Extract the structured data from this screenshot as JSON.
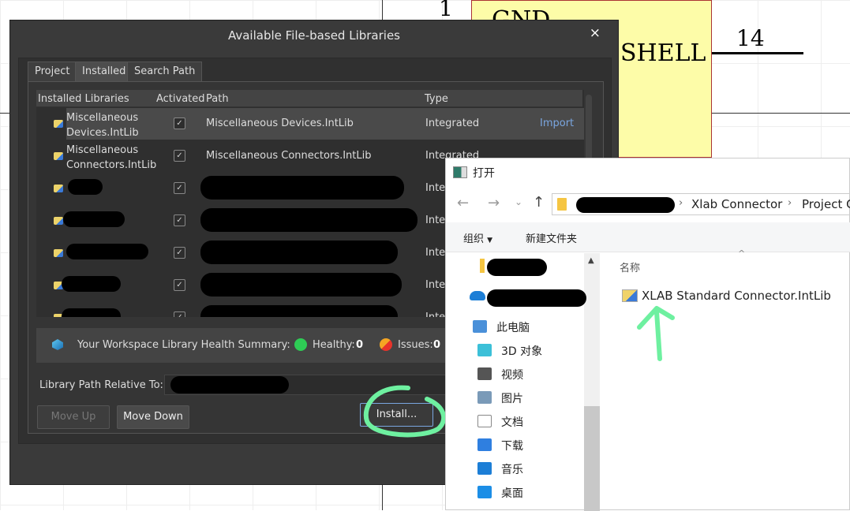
{
  "schematic": {
    "pin_number_left": "1",
    "pin_number_right": "14",
    "label_gnd": "GND",
    "label_shell": "SHELL",
    "component_fill": "#fdfca8"
  },
  "dialog": {
    "title": "Available File-based Libraries",
    "close_label": "×",
    "tabs": [
      {
        "label": "Project"
      },
      {
        "label": "Installed",
        "active": true
      },
      {
        "label": "Search Path"
      }
    ],
    "columns": [
      "Installed Libraries",
      "Activated",
      "Path",
      "Type"
    ],
    "rows": [
      {
        "name_line1": "Miscellaneous",
        "name_line2": "Devices.IntLib",
        "activated": true,
        "path": "Miscellaneous Devices.IntLib",
        "type": "Integrated",
        "action": "Import"
      },
      {
        "name_line1": "Miscellaneous",
        "name_line2": "Connectors.IntLib",
        "activated": true,
        "path": "Miscellaneous Connectors.IntLib",
        "type": "Integrated"
      },
      {
        "activated": true,
        "type": "Inte"
      },
      {
        "activated": true,
        "type": "Inte"
      },
      {
        "activated": true,
        "type": "Inte"
      },
      {
        "activated": true,
        "type": "Inte"
      },
      {
        "activated": true,
        "type": "Inte"
      }
    ],
    "health": {
      "label": "Your Workspace Library Health Summary:",
      "healthy_label": "Healthy:",
      "healthy_count": "0",
      "issues_label": "Issues:",
      "issues_count": "0",
      "healthy_color": "#2ecc55",
      "issues_color": "#f06a2a"
    },
    "relative_label": "Library Path Relative To:",
    "buttons": {
      "move_up": "Move Up",
      "move_down": "Move Down",
      "install": "Install..."
    },
    "accent": "#7aa6e0"
  },
  "explorer": {
    "title": "打开",
    "breadcrumb": [
      "Xlab Connector",
      "Project C"
    ],
    "toolbar": {
      "organize": "组织",
      "new_folder": "新建文件夹"
    },
    "column_name": "名称",
    "nav": [
      {
        "label": "此电脑",
        "icon": "computer-icon"
      },
      {
        "label": "3D 对象",
        "icon": "cube-icon"
      },
      {
        "label": "视频",
        "icon": "video-icon"
      },
      {
        "label": "图片",
        "icon": "picture-icon"
      },
      {
        "label": "文档",
        "icon": "document-icon"
      },
      {
        "label": "下载",
        "icon": "download-icon"
      },
      {
        "label": "音乐",
        "icon": "music-icon"
      },
      {
        "label": "桌面",
        "icon": "desktop-icon"
      }
    ],
    "files": [
      {
        "name": "XLAB Standard Connector.IntLib",
        "icon": "intlib-icon"
      }
    ]
  },
  "annotation_color": "#6ef0a0"
}
